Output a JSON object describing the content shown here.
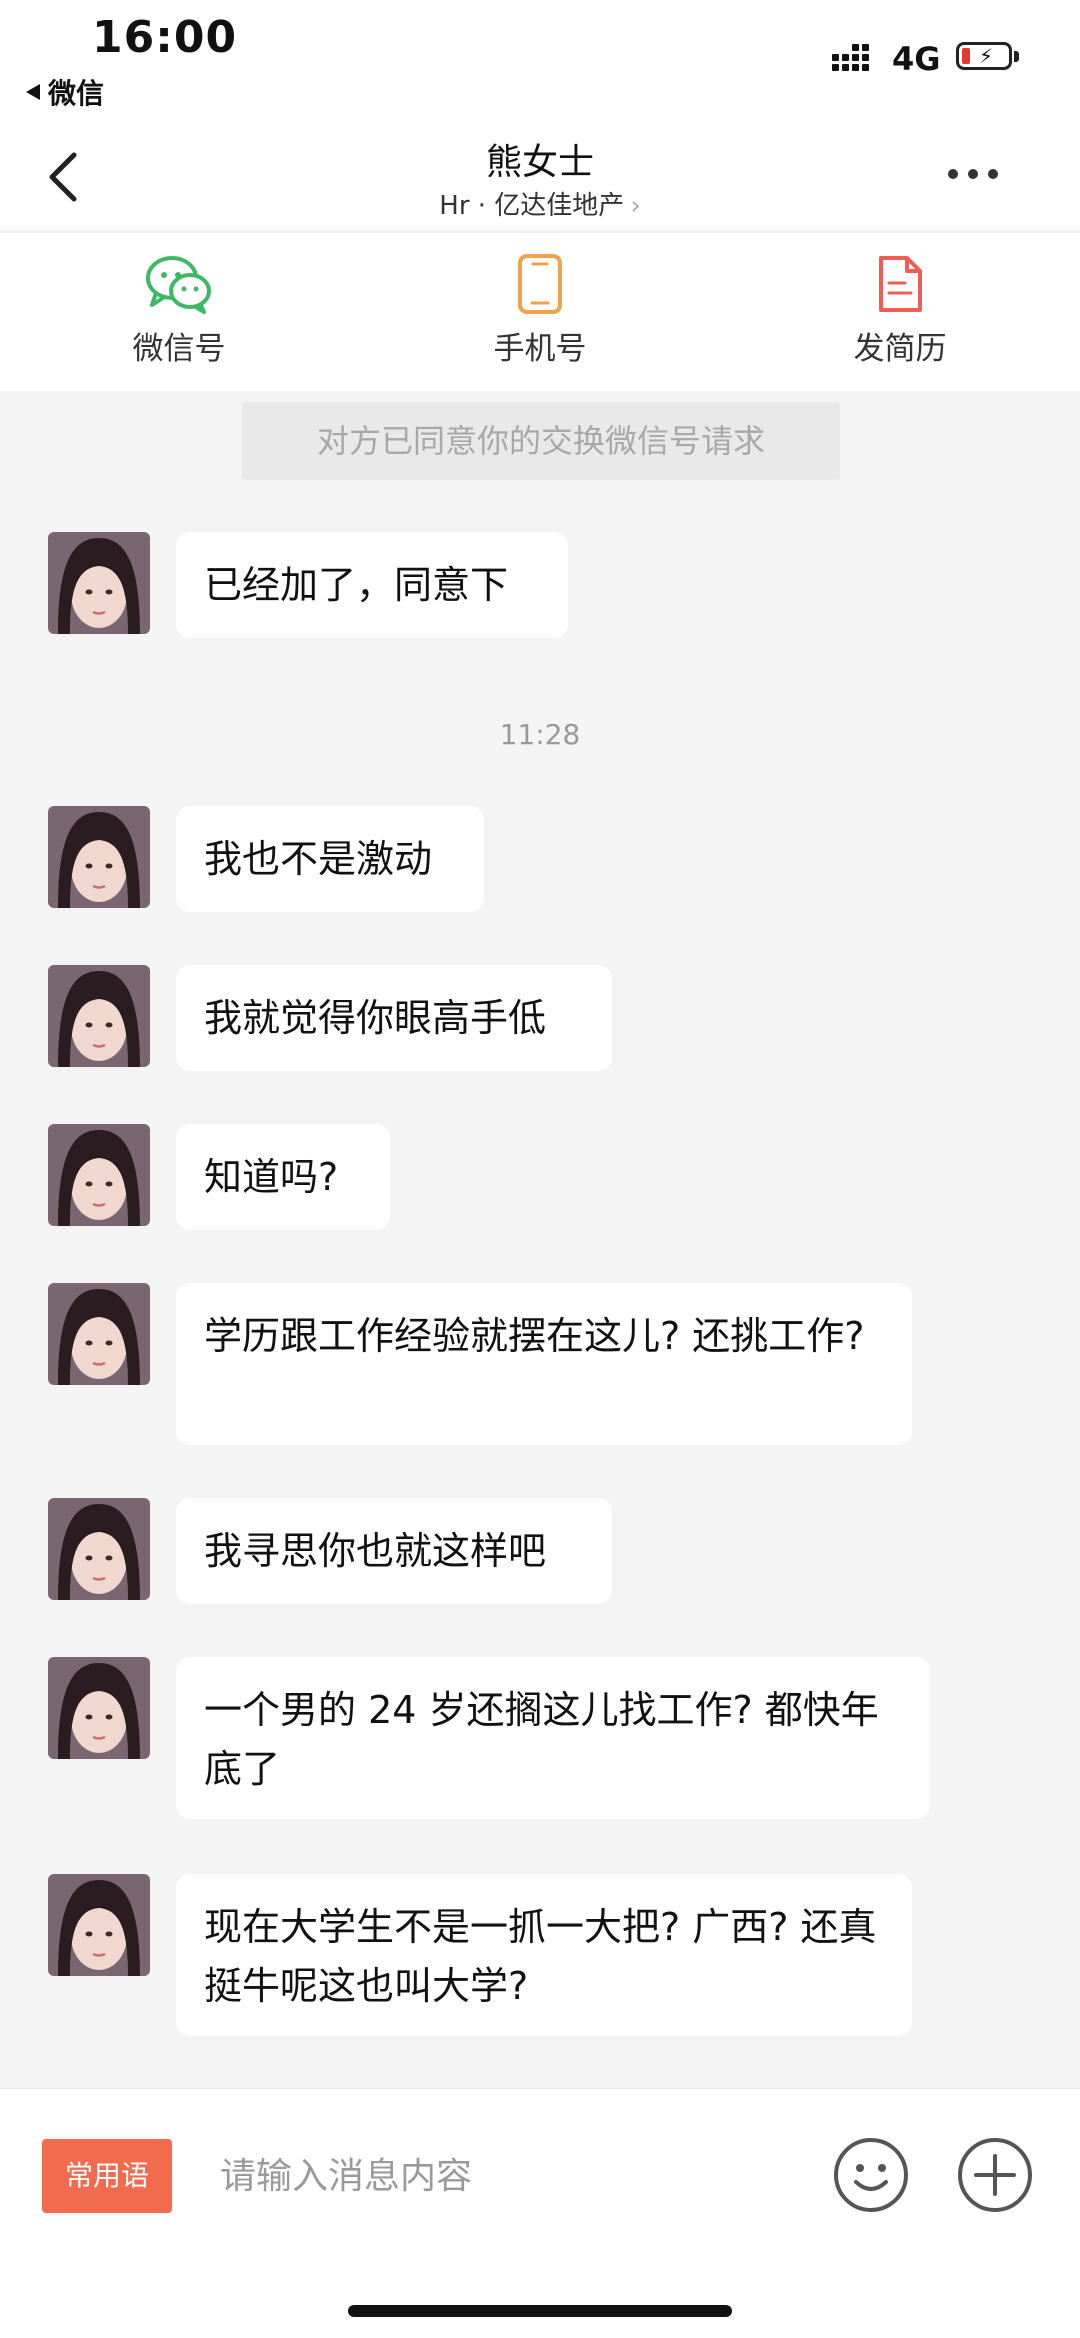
{
  "status_bar": {
    "time": "16:00",
    "back_app": "微信",
    "network": "4G",
    "battery_percent": 15
  },
  "header": {
    "title": "熊女士",
    "subtitle": "Hr · 亿达佳地产"
  },
  "actions": [
    {
      "label": "微信号",
      "icon": "wechat-icon",
      "color": "#3fb866"
    },
    {
      "label": "手机号",
      "icon": "phone-icon",
      "color": "#f0a24a"
    },
    {
      "label": "发简历",
      "icon": "resume-icon",
      "color": "#ee5e55"
    }
  ],
  "system_notice": "对方已同意你的交换微信号请求",
  "timestamp": "11:28",
  "messages": [
    {
      "text": "已经加了，同意下"
    },
    {
      "text": "我也不是激动"
    },
    {
      "text": "我就觉得你眼高手低"
    },
    {
      "text": "知道吗?"
    },
    {
      "text": "学历跟工作经验就摆在这儿? 还挑工作?"
    },
    {
      "text": "我寻思你也就这样吧"
    },
    {
      "text": "一个男的 24 岁还搁这儿找工作? 都快年底了"
    },
    {
      "text": "现在大学生不是一抓一大把? 广西? 还真挺牛呢这也叫大学?"
    }
  ],
  "input_bar": {
    "phrases_label": "常用语",
    "placeholder": "请输入消息内容"
  },
  "colors": {
    "accent": "#f26b4f",
    "background": "#f4f4f4"
  }
}
